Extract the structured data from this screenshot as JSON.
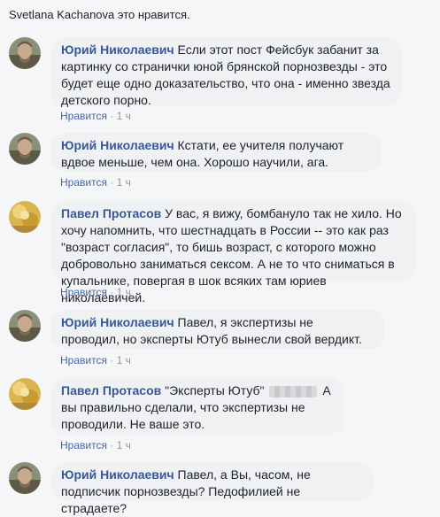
{
  "top_note": "Svetlana Kachanova это нравится.",
  "actions": {
    "like": "Нравится",
    "dot": " · ",
    "time": "1 ч"
  },
  "comments": [
    {
      "author": "Юрий Николаевич",
      "text": "Если этот пост Фейсбук забанит за картинку со странички юной брянской порнозвезды - это будет еще одно доказательство, что она - именно звезда детского порно."
    },
    {
      "author": "Юрий Николаевич",
      "text": "Кстати, ее учителя получают вдвое меньше, чем она. Хорошо научили, ага."
    },
    {
      "author": "Павел Протасов",
      "text": "У вас, я вижу, бомбануло так не хило. Но хочу напомнить, что шестнадцать в России -- это как раз \"возраст согласия\", то бишь возраст, с которого можно добровольно заниматься сексом. А не то что сниматься в купальнике, повергая в шок всяких там юриев николаевичей."
    },
    {
      "author": "Юрий Николаевич",
      "text": "Павел, я экспертизы не проводил, но эксперты Ютуб вынесли свой вердикт."
    },
    {
      "author": "Павел Протасов",
      "text_before": "\"Эксперты Ютуб\"",
      "text_after": "А вы правильно сделали, что экспертизы не проводили. Не ваше это."
    },
    {
      "author": "Юрий Николаевич",
      "text": "Павел, а Вы, часом, не подписчик порнозвезды? Педофилией не страдаете?"
    }
  ]
}
